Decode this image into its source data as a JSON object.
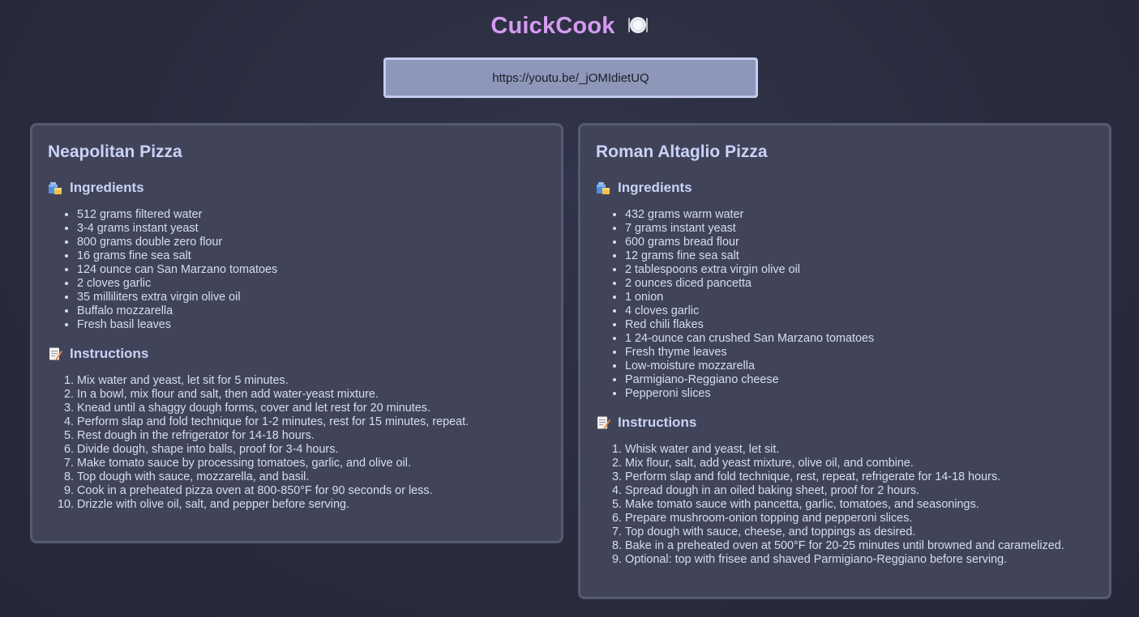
{
  "app": {
    "title": "CuickCook",
    "title_icon": "plate-icon",
    "accent_color": "#d49cf0"
  },
  "url_input": {
    "value": "https://youtu.be/_jOMIdietUQ"
  },
  "recipes": [
    {
      "title": "Neapolitan Pizza",
      "ingredients_heading": "Ingredients",
      "ingredients_icon": "ingredients-icon",
      "ingredients": [
        "512 grams filtered water",
        "3-4 grams instant yeast",
        "800 grams double zero flour",
        "16 grams fine sea salt",
        "124 ounce can San Marzano tomatoes",
        "2 cloves garlic",
        "35 milliliters extra virgin olive oil",
        "Buffalo mozzarella",
        "Fresh basil leaves"
      ],
      "instructions_heading": "Instructions",
      "instructions_icon": "memo-icon",
      "instructions": [
        "Mix water and yeast, let sit for 5 minutes.",
        "In a bowl, mix flour and salt, then add water-yeast mixture.",
        "Knead until a shaggy dough forms, cover and let rest for 20 minutes.",
        "Perform slap and fold technique for 1-2 minutes, rest for 15 minutes, repeat.",
        "Rest dough in the refrigerator for 14-18 hours.",
        "Divide dough, shape into balls, proof for 3-4 hours.",
        "Make tomato sauce by processing tomatoes, garlic, and olive oil.",
        "Top dough with sauce, mozzarella, and basil.",
        "Cook in a preheated pizza oven at 800-850°F for 90 seconds or less.",
        "Drizzle with olive oil, salt, and pepper before serving."
      ]
    },
    {
      "title": "Roman Altaglio Pizza",
      "ingredients_heading": "Ingredients",
      "ingredients_icon": "ingredients-icon",
      "ingredients": [
        "432 grams warm water",
        "7 grams instant yeast",
        "600 grams bread flour",
        "12 grams fine sea salt",
        "2 tablespoons extra virgin olive oil",
        "2 ounces diced pancetta",
        "1 onion",
        "4 cloves garlic",
        "Red chili flakes",
        "1 24-ounce can crushed San Marzano tomatoes",
        "Fresh thyme leaves",
        "Low-moisture mozzarella",
        "Parmigiano-Reggiano cheese",
        "Pepperoni slices"
      ],
      "instructions_heading": "Instructions",
      "instructions_icon": "memo-icon",
      "instructions": [
        "Whisk water and yeast, let sit.",
        "Mix flour, salt, add yeast mixture, olive oil, and combine.",
        "Perform slap and fold technique, rest, repeat, refrigerate for 14-18 hours.",
        "Spread dough in an oiled baking sheet, proof for 2 hours.",
        "Make tomato sauce with pancetta, garlic, tomatoes, and seasonings.",
        "Prepare mushroom-onion topping and pepperoni slices.",
        "Top dough with sauce, cheese, and toppings as desired.",
        "Bake in a preheated oven at 500°F for 20-25 minutes until browned and caramelized.",
        "Optional: top with frisee and shaved Parmigiano-Reggiano before serving."
      ]
    }
  ]
}
